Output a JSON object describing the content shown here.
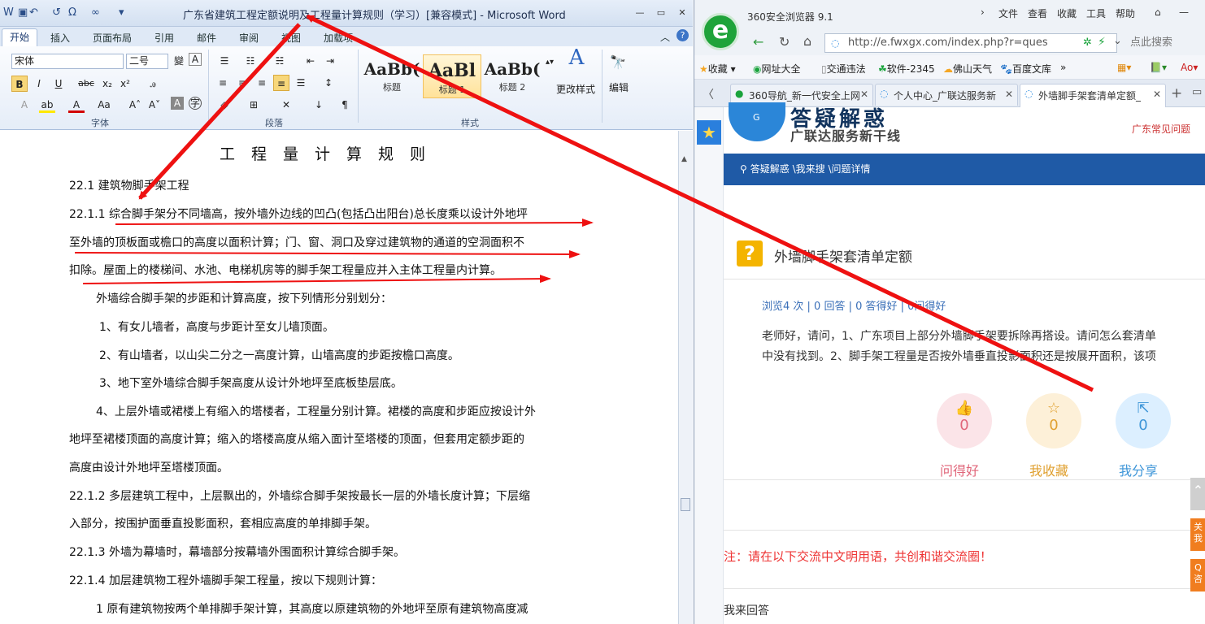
{
  "word": {
    "window_title": "广东省建筑工程定额说明及工程量计算规则（学习）[兼容模式] - Microsoft Word",
    "tabs": [
      "开始",
      "插入",
      "页面布局",
      "引用",
      "邮件",
      "审阅",
      "视图",
      "加载项"
    ],
    "font_name": "宋体",
    "font_size": "二号",
    "group_font": "字体",
    "group_paragraph": "段落",
    "group_styles": "样式",
    "styles": [
      {
        "sample": "AaBb(",
        "name": "标题"
      },
      {
        "sample": "AaBl",
        "name": "标题 1"
      },
      {
        "sample": "AaBb(",
        "name": "标题 2"
      }
    ],
    "change_styles": "更改样式",
    "edit": "编辑",
    "doc": {
      "title": "工程量计算规则",
      "lines": [
        "22.1 建筑物脚手架工程",
        "22.1.1 综合脚手架分不同墙高，按外墙外边线的凹凸(包括凸出阳台)总长度乘以设计外地坪",
        "至外墙的顶板面或檐口的高度以面积计算；门、窗、洞口及穿过建筑物的通道的空洞面积不",
        "扣除。屋面上的楼梯间、水池、电梯机房等的脚手架工程量应并入主体工程量内计算。",
        "外墙综合脚手架的步距和计算高度，按下列情形分别划分：",
        "1、有女儿墙者，高度与步距计至女儿墙顶面。",
        "2、有山墙者，以山尖二分之一高度计算，山墙高度的步距按檐口高度。",
        "3、地下室外墙综合脚手架高度从设计外地坪至底板垫层底。",
        "4、上层外墙或裙楼上有缩入的塔楼者，工程量分别计算。裙楼的高度和步距应按设计外",
        "地坪至裙楼顶面的高度计算；缩入的塔楼高度从缩入面计至塔楼的顶面，但套用定额步距的",
        "高度由设计外地坪至塔楼顶面。",
        "22.1.2 多层建筑工程中，上层飘出的，外墙综合脚手架按最长一层的外墙长度计算；下层缩",
        "入部分，按围护面垂直投影面积，套相应高度的单排脚手架。",
        "22.1.3 外墙为幕墙时，幕墙部分按幕墙外围面积计算综合脚手架。",
        "22.1.4 加层建筑物工程外墙脚手架工程量，按以下规则计算：",
        "1  原有建筑物按两个单排脚手架计算，其高度以原建筑物的外地坪至原有建筑物高度减"
      ]
    }
  },
  "browser": {
    "name": "360安全浏览器 9.1",
    "menu": [
      "文件",
      "查看",
      "收藏",
      "工具",
      "帮助"
    ],
    "url": "http://e.fwxgx.com/index.php?r=ques",
    "search_placeholder": "点此搜索",
    "favorites": [
      "收藏",
      "网址大全",
      "交通违法",
      "软件-2345",
      "佛山天气",
      "百度文库"
    ],
    "tabs": [
      "360导航_新一代安全上网",
      "个人中心_广联达服务新",
      "外墙脚手架套清单定额_"
    ],
    "site_title": "答疑解惑",
    "site_subtitle": "广联达服务新干线",
    "site_corner": "广东常见问题",
    "breadcrumb": "答疑解惑 \\我来搜 \\问题详情",
    "question_title": "外墙脚手架套清单定额",
    "stats": "浏览4 次 | 0 回答 | 0 答得好 | 0问得好",
    "question_lines": [
      "老师好，请问，1、广东项目上部分外墙脚手架要拆除再搭设。请问怎么套清单",
      "中没有找到。2、脚手架工程量是否按外墙垂直投影面积还是按展开面积，该项"
    ],
    "actions": [
      {
        "label": "问得好",
        "count": "0",
        "color": "#e0667a"
      },
      {
        "label": "我收藏",
        "count": "0",
        "color": "#e0a030"
      },
      {
        "label": "我分享",
        "count": "0",
        "color": "#3d95d8"
      }
    ],
    "notice": "注：请在以下交流中文明用语，共创和谐交流圈！",
    "my_answer": "我来回答",
    "side_buttons": [
      "关我",
      "Q咨"
    ]
  }
}
